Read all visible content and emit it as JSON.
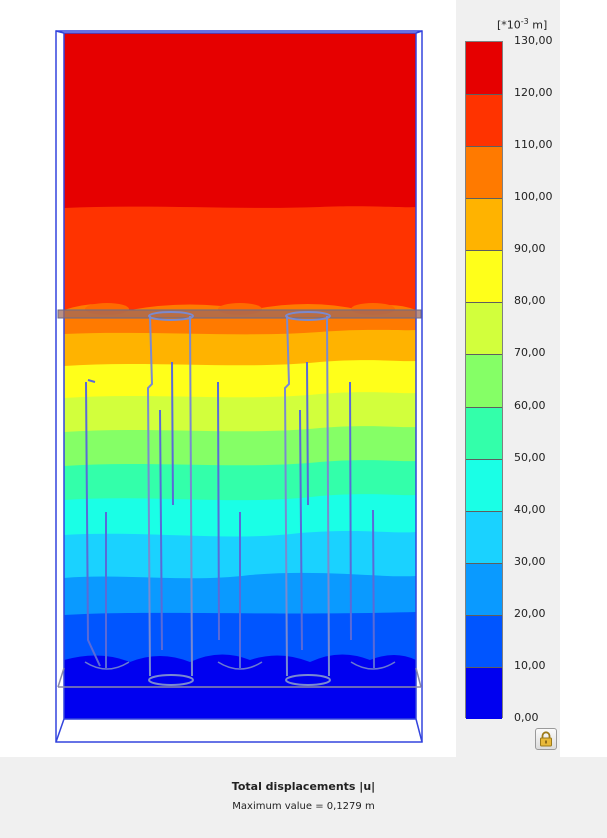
{
  "caption": {
    "title": "Total displacements |u|",
    "subtitle": "Maximum value = 0,1279 m"
  },
  "legend": {
    "unit_prefix": "[*10",
    "unit_exponent": "-3",
    "unit_suffix": " m]",
    "ticks": [
      "130,00",
      "120,00",
      "110,00",
      "100,00",
      "90,00",
      "80,00",
      "70,00",
      "60,00",
      "50,00",
      "40,00",
      "30,00",
      "20,00",
      "10,00",
      "0,00"
    ],
    "colors": [
      "#e60000",
      "#ff3300",
      "#ff7a00",
      "#ffb300",
      "#ffff1a",
      "#d2ff3c",
      "#85ff66",
      "#33ffaa",
      "#1affe6",
      "#1ad2ff",
      "#0a9aff",
      "#0055ff",
      "#0000f0"
    ]
  },
  "lock_button": {
    "icon": "lock-icon"
  }
}
